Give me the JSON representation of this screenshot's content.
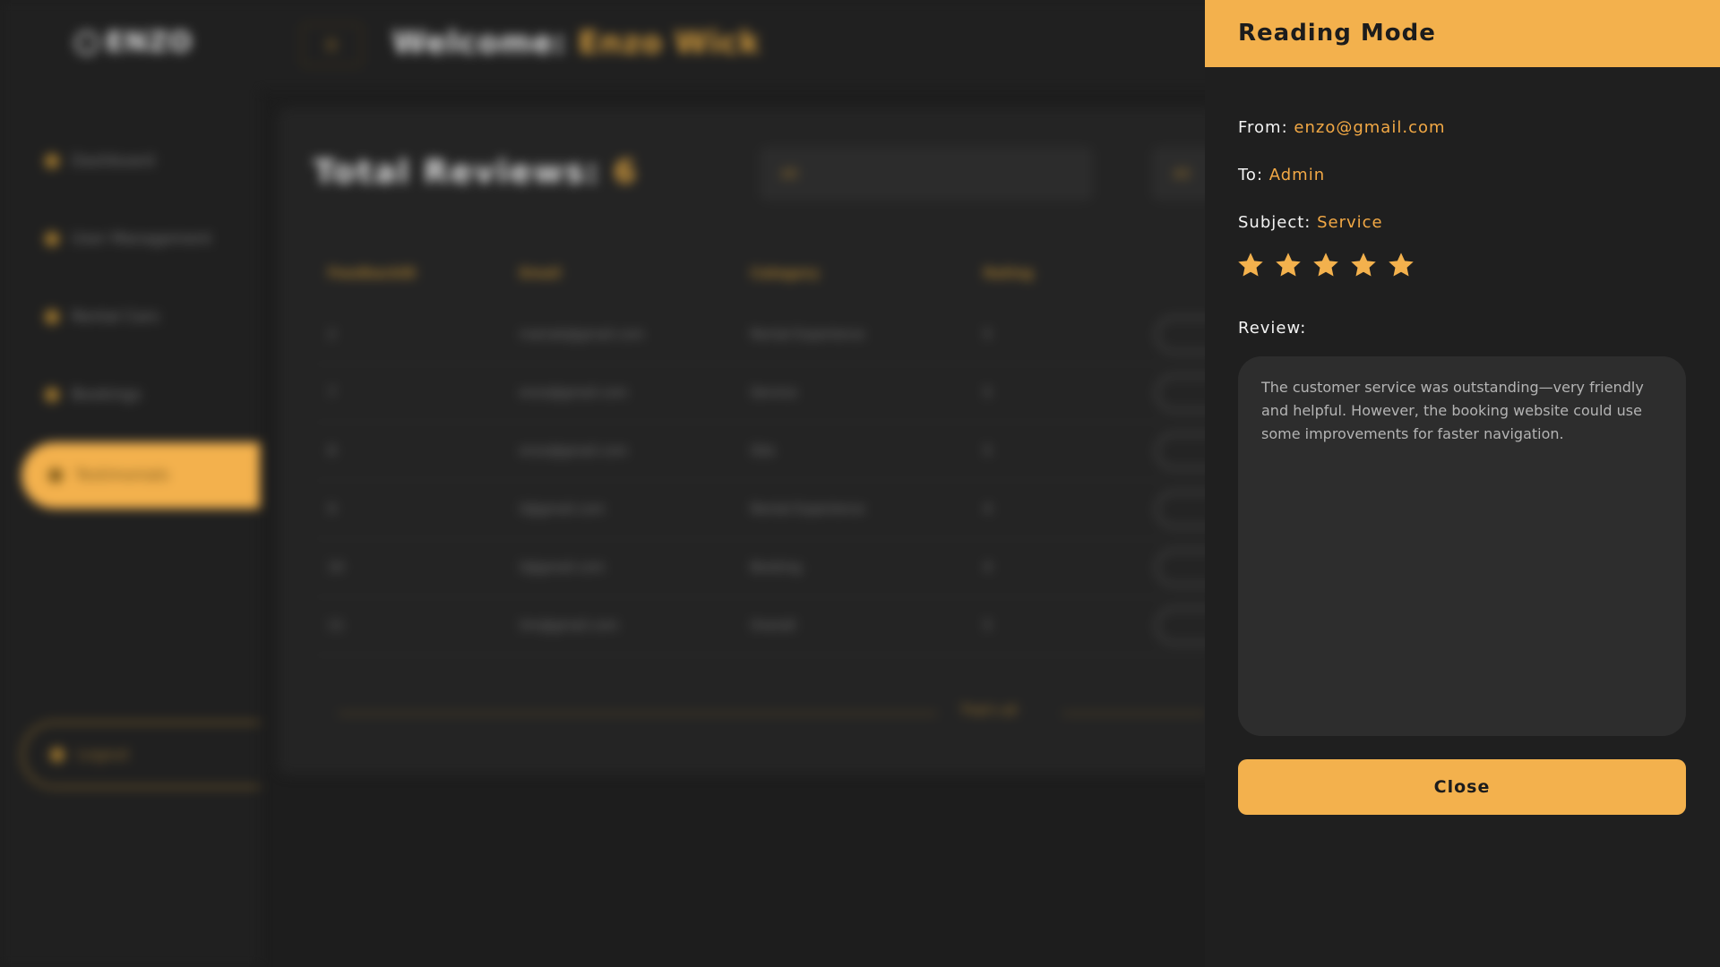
{
  "app": {
    "logo_text": "ENZO",
    "welcome_label": "Welcome:",
    "user_name": "Enzo Wick"
  },
  "sidebar": {
    "items": [
      {
        "label": "Dashboard"
      },
      {
        "label": "User Management"
      },
      {
        "label": "Rental Cars"
      },
      {
        "label": "Bookings"
      },
      {
        "label": "Testimonials"
      }
    ],
    "logout_label": "Logout"
  },
  "main": {
    "total_label": "Total Reviews:",
    "total_count": "6",
    "search_placeholder": "All",
    "filter_label": "All",
    "columns": [
      "FeedbackID",
      "Email",
      "Category",
      "Rating"
    ],
    "rows": [
      {
        "id": "2",
        "email": "mainak@gmail.com",
        "category": "Rental Experience",
        "rating": "5"
      },
      {
        "id": "7",
        "email": "enzo@gmail.com",
        "category": "Service",
        "rating": "5"
      },
      {
        "id": "8",
        "email": "enzo@gmail.com",
        "category": "Site",
        "rating": "5"
      },
      {
        "id": "9",
        "email": "li@gmail.com",
        "category": "Rental Experience",
        "rating": "4"
      },
      {
        "id": "10",
        "email": "li@gmail.com",
        "category": "Booking",
        "rating": "4"
      },
      {
        "id": "11",
        "email": "tim@gmail.com",
        "category": "Overall",
        "rating": "5"
      }
    ],
    "pager_text": "That's all"
  },
  "reading_mode": {
    "title": "Reading Mode",
    "from_label": "From:",
    "from_value": "enzo@gmail.com",
    "to_label": "To:",
    "to_value": "Admin",
    "subject_label": "Subject:",
    "subject_value": "Service",
    "rating": 5,
    "review_label": "Review:",
    "review_text": "The customer service was outstanding—very friendly and helpful. However, the booking website could use some improvements for faster navigation.",
    "close_label": "Close"
  },
  "colors": {
    "accent": "#f3b14d",
    "background": "#1d1d1d",
    "panel": "#1f1f1f"
  }
}
